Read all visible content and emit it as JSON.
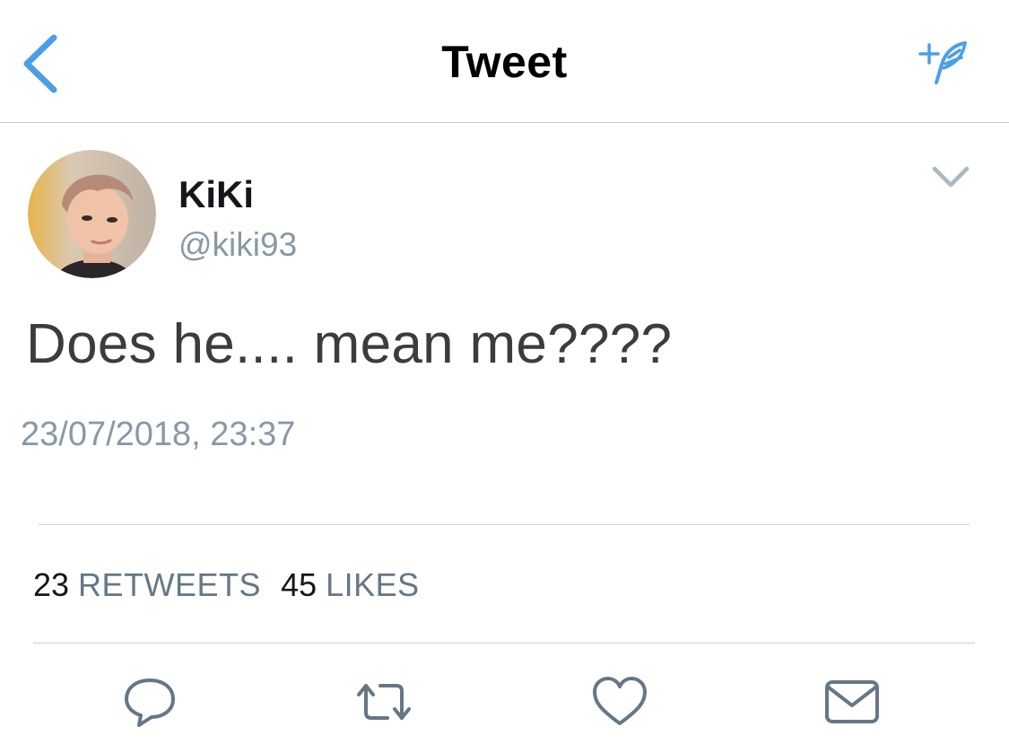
{
  "header": {
    "title": "Tweet",
    "back_icon": "chevron-left-icon",
    "compose_icon": "compose-feather-icon"
  },
  "tweet": {
    "display_name": "KiKi",
    "handle": "@kiki93",
    "text": "Does he.... mean me????",
    "timestamp": "23/07/2018, 23:37",
    "more_icon": "chevron-down-icon"
  },
  "stats": {
    "retweets_count": "23",
    "retweets_label": "RETWEETS",
    "likes_count": "45",
    "likes_label": "LIKES"
  },
  "actions": [
    {
      "name": "reply",
      "icon": "reply-icon"
    },
    {
      "name": "retweet",
      "icon": "retweet-icon"
    },
    {
      "name": "like",
      "icon": "heart-icon"
    },
    {
      "name": "direct-message",
      "icon": "envelope-icon"
    }
  ],
  "colors": {
    "accent": "#1da1f2",
    "text_primary": "#14171a",
    "text_secondary": "#8899a6",
    "stat_label": "#657786",
    "divider": "#c9d3dc",
    "icon_gray": "#657786"
  }
}
